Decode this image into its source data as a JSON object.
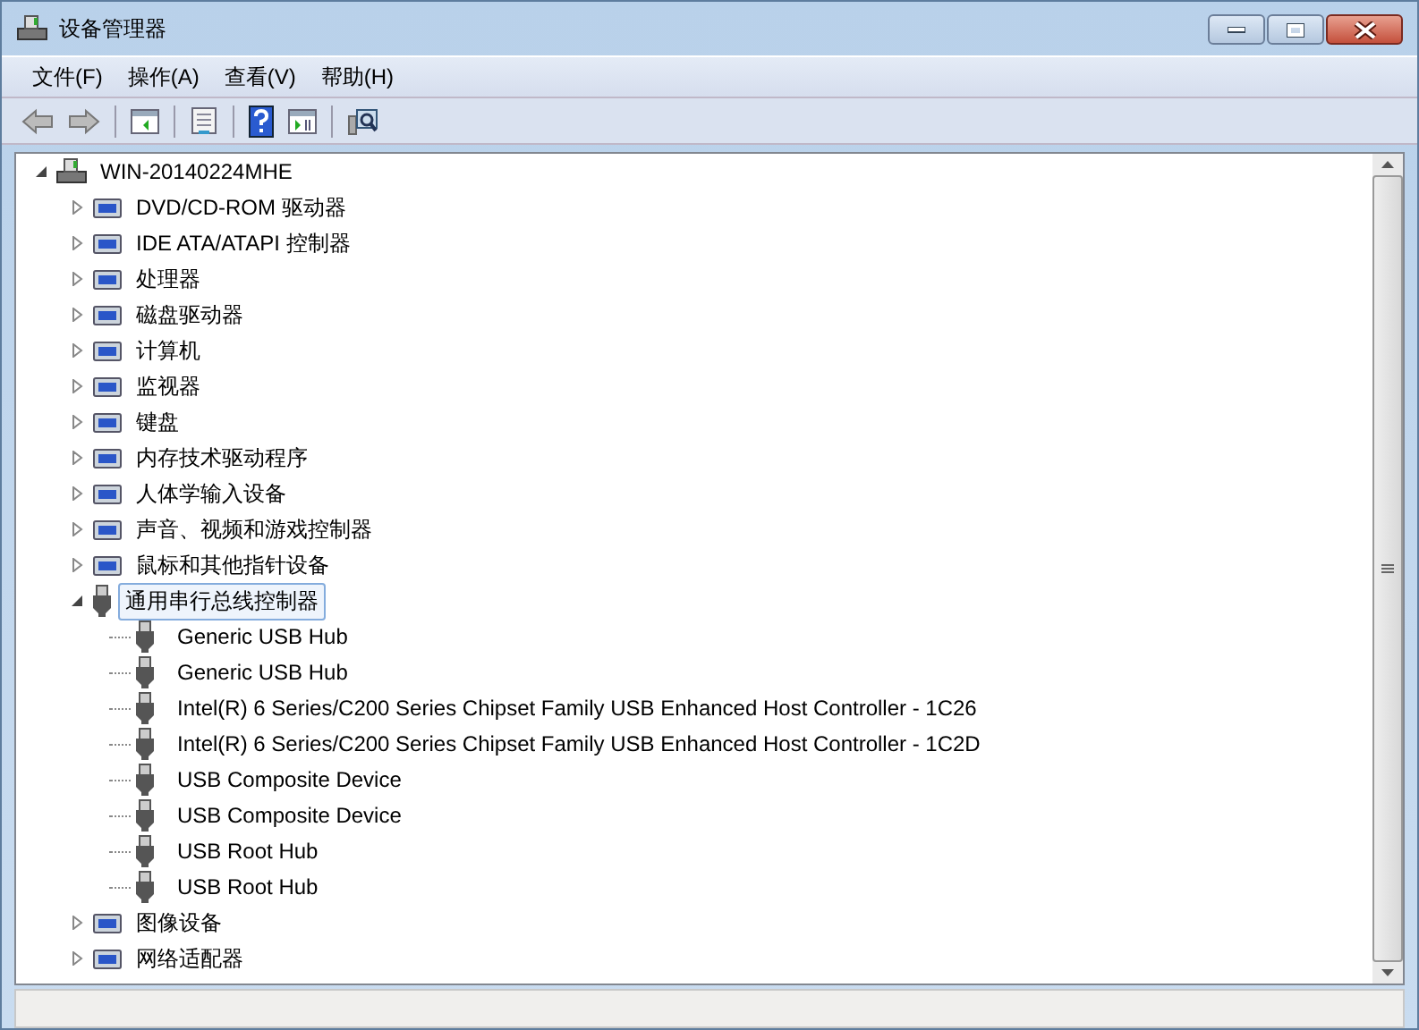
{
  "window": {
    "title": "设备管理器"
  },
  "menu": [
    {
      "label": "文件(F)"
    },
    {
      "label": "操作(A)"
    },
    {
      "label": "查看(V)"
    },
    {
      "label": "帮助(H)"
    }
  ],
  "toolbar": [
    {
      "kind": "back",
      "disabled": false
    },
    {
      "kind": "forward",
      "disabled": false
    },
    {
      "kind": "sep"
    },
    {
      "kind": "tree",
      "disabled": false
    },
    {
      "kind": "sep"
    },
    {
      "kind": "properties",
      "disabled": false
    },
    {
      "kind": "sep"
    },
    {
      "kind": "help",
      "disabled": false
    },
    {
      "kind": "pane",
      "disabled": false
    },
    {
      "kind": "sep"
    },
    {
      "kind": "scan",
      "disabled": false
    }
  ],
  "tree": {
    "label": "WIN-20140224MHE",
    "expanded": true,
    "selected": false,
    "children": [
      {
        "label": "DVD/CD-ROM 驱动器",
        "expanded": false,
        "selected": false
      },
      {
        "label": "IDE ATA/ATAPI 控制器",
        "expanded": false,
        "selected": false
      },
      {
        "label": "处理器",
        "expanded": false,
        "selected": false
      },
      {
        "label": "磁盘驱动器",
        "expanded": false,
        "selected": false
      },
      {
        "label": "计算机",
        "expanded": false,
        "selected": false
      },
      {
        "label": "监视器",
        "expanded": false,
        "selected": false
      },
      {
        "label": "键盘",
        "expanded": false,
        "selected": false
      },
      {
        "label": "内存技术驱动程序",
        "expanded": false,
        "selected": false
      },
      {
        "label": "人体学输入设备",
        "expanded": false,
        "selected": false
      },
      {
        "label": "声音、视频和游戏控制器",
        "expanded": false,
        "selected": false
      },
      {
        "label": "鼠标和其他指针设备",
        "expanded": false,
        "selected": false
      },
      {
        "label": "通用串行总线控制器",
        "expanded": true,
        "selected": true,
        "children": [
          {
            "label": "Generic USB Hub",
            "selected": false
          },
          {
            "label": "Generic USB Hub",
            "selected": false
          },
          {
            "label": "Intel(R) 6 Series/C200 Series Chipset Family USB Enhanced Host Controller - 1C26",
            "selected": false
          },
          {
            "label": "Intel(R) 6 Series/C200 Series Chipset Family USB Enhanced Host Controller - 1C2D",
            "selected": false
          },
          {
            "label": "USB Composite Device",
            "selected": false
          },
          {
            "label": "USB Composite Device",
            "selected": false
          },
          {
            "label": "USB Root Hub",
            "selected": false
          },
          {
            "label": "USB Root Hub",
            "selected": false
          }
        ]
      },
      {
        "label": "图像设备",
        "expanded": false,
        "selected": false
      },
      {
        "label": "网络适配器",
        "expanded": false,
        "selected": false
      }
    ]
  }
}
